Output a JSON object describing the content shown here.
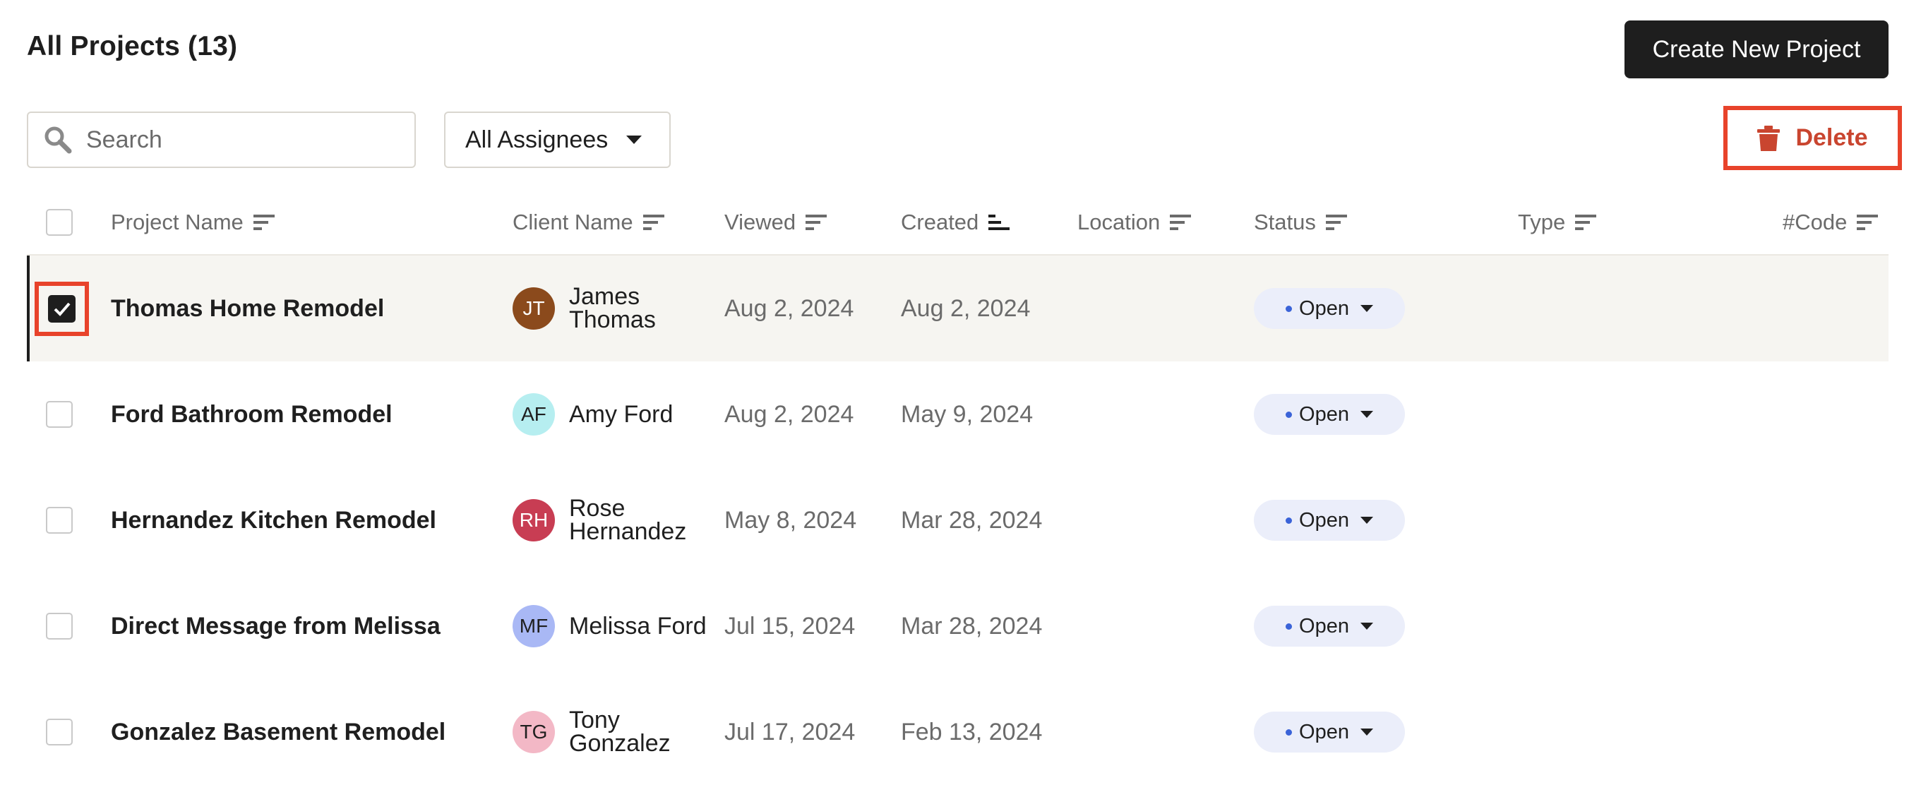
{
  "header": {
    "title": "All Projects (13)",
    "create_button": "Create New Project"
  },
  "toolbar": {
    "search_placeholder": "Search",
    "assignee_filter": "All Assignees",
    "delete_label": "Delete"
  },
  "colors": {
    "primary_dark": "#1e1e1e",
    "delete_red": "#c9452f",
    "highlight_red": "#e8432b",
    "status_bg": "#ebeefa",
    "status_dot": "#3a63d8"
  },
  "table": {
    "columns": [
      "Project Name",
      "Client Name",
      "Viewed",
      "Created",
      "Location",
      "Status",
      "Type",
      "#Code"
    ],
    "rows": [
      {
        "project": "Thomas Home Remodel",
        "initials": "JT",
        "client": "James Thomas",
        "viewed": "Aug 2, 2024",
        "created": "Aug 2, 2024",
        "status": "Open",
        "selected": true,
        "avatar_bg": "#8b4a1c",
        "avatar_fg": "#ffffff"
      },
      {
        "project": "Ford Bathroom Remodel",
        "initials": "AF",
        "client": "Amy Ford",
        "viewed": "Aug 2, 2024",
        "created": "May 9, 2024",
        "status": "Open",
        "selected": false,
        "avatar_bg": "#b6eef0",
        "avatar_fg": "#1f1f1f"
      },
      {
        "project": "Hernandez Kitchen Remodel",
        "initials": "RH",
        "client": "Rose Hernandez",
        "viewed": "May 8, 2024",
        "created": "Mar 28, 2024",
        "status": "Open",
        "selected": false,
        "avatar_bg": "#c83d53",
        "avatar_fg": "#ffffff"
      },
      {
        "project": "Direct Message from Melissa",
        "initials": "MF",
        "client": "Melissa Ford",
        "viewed": "Jul 15, 2024",
        "created": "Mar 28, 2024",
        "status": "Open",
        "selected": false,
        "avatar_bg": "#a9b8f5",
        "avatar_fg": "#1f1f1f"
      },
      {
        "project": "Gonzalez Basement Remodel",
        "initials": "TG",
        "client": "Tony Gonzalez",
        "viewed": "Jul 17, 2024",
        "created": "Feb 13, 2024",
        "status": "Open",
        "selected": false,
        "avatar_bg": "#f3b8c6",
        "avatar_fg": "#1f1f1f"
      }
    ]
  }
}
